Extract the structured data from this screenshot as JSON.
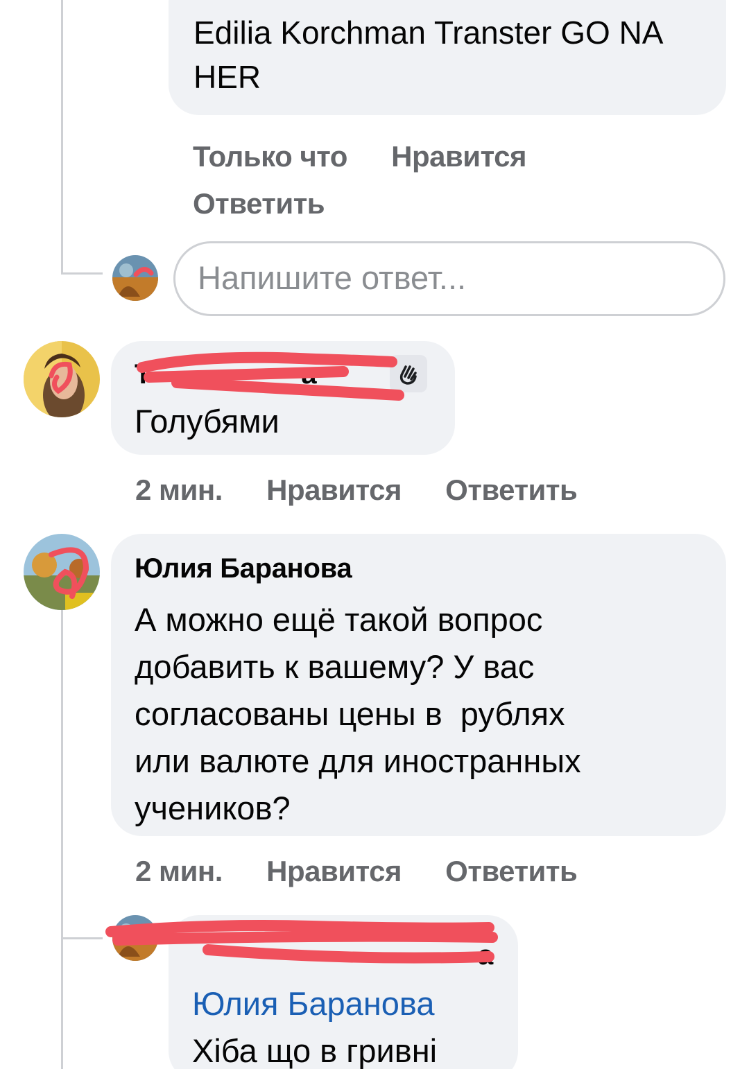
{
  "comment_top": {
    "text": "Edilia Korchman Transter GO NA HER",
    "time": "Только что",
    "like_label": "Нравится",
    "reply_label": "Ответить"
  },
  "reply_input": {
    "placeholder": "Напишите ответ..."
  },
  "comment_2": {
    "author": "Т                    а",
    "badge_icon": "waving-hand-icon",
    "text": "Голубями",
    "time": "2 мин.",
    "like_label": "Нравится",
    "reply_label": "Ответить"
  },
  "comment_3": {
    "author": "Юлия Баранова",
    "text_lines": [
      "А можно ещё такой вопрос",
      "добавить к вашему? У вас",
      "согласованы цены в  рублях",
      "или валюте для иностранных",
      "учеников?"
    ],
    "time": "2 мин.",
    "like_label": "Нравится",
    "reply_label": "Ответить"
  },
  "comment_4": {
    "author": "а",
    "mention": "Юлия Баранова",
    "text": "Хіба що в гривні"
  },
  "colors": {
    "bubble_bg": "#f0f2f5",
    "action_text": "#65676b",
    "mention": "#1a5fb4",
    "redaction": "#f0505c"
  }
}
